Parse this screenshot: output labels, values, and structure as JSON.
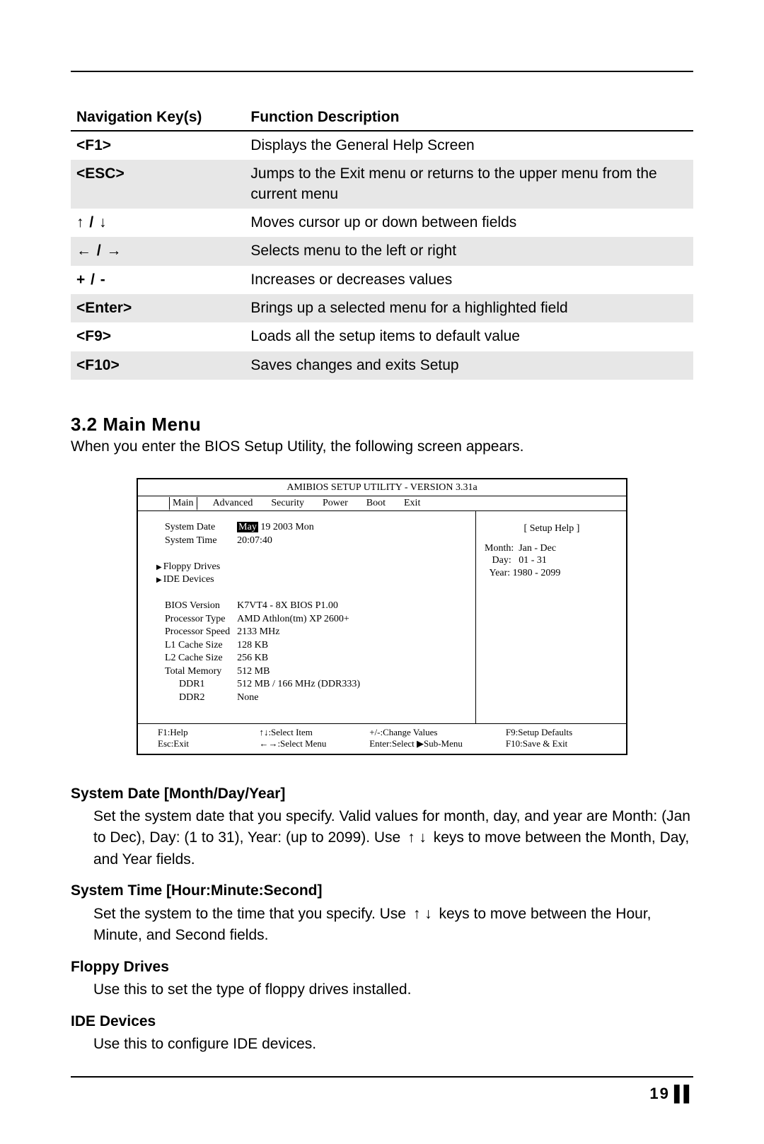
{
  "nav_table": {
    "headers": [
      "Navigation Key(s)",
      "Function Description"
    ],
    "rows": [
      {
        "key": "<F1>",
        "desc": "Displays the General Help Screen",
        "shade": false
      },
      {
        "key": "<ESC>",
        "desc": "Jumps to the Exit menu or returns to the upper menu from the current menu",
        "shade": true
      },
      {
        "key": "↑  /  ↓",
        "desc": "Moves cursor up or down between fields",
        "shade": false,
        "sym": true
      },
      {
        "key": "←  /  →",
        "desc": "Selects menu to the left or right",
        "shade": true,
        "sym": true
      },
      {
        "key": "+  /  -",
        "desc": "Increases or decreases values",
        "shade": false,
        "sym": true
      },
      {
        "key": "<Enter>",
        "desc": "Brings up a selected menu for a highlighted field",
        "shade": true
      },
      {
        "key": "<F9>",
        "desc": "Loads all the setup items to default value",
        "shade": false
      },
      {
        "key": "<F10>",
        "desc": "Saves changes and exits Setup",
        "shade": true
      }
    ]
  },
  "section": {
    "heading": "3.2 Main Menu",
    "intro": "When you enter the BIOS Setup Utility, the following screen appears."
  },
  "bios": {
    "title": "AMIBIOS SETUP UTILITY - VERSION 3.31a",
    "tabs": [
      "Main",
      "Advanced",
      "Security",
      "Power",
      "Boot",
      "Exit"
    ],
    "active_tab": 0,
    "date_label": "System Date",
    "date_value_hi": "May",
    "date_value_rest": "19 2003 Mon",
    "time_label": "System Time",
    "time_value": "20:07:40",
    "submenus": [
      "Floppy Drives",
      "IDE Devices"
    ],
    "info": [
      {
        "label": "BIOS Version",
        "value": "K7VT4 - 8X  BIOS  P1.00"
      },
      {
        "label": "Processor Type",
        "value": "AMD Athlon(tm) XP 2600+"
      },
      {
        "label": "Processor Speed",
        "value": "2133 MHz"
      },
      {
        "label": "L1 Cache Size",
        "value": "128 KB"
      },
      {
        "label": "L2 Cache Size",
        "value": "256 KB"
      },
      {
        "label": "Total Memory",
        "value": "512 MB"
      },
      {
        "label": "DDR1",
        "value": "512 MB / 166 MHz (DDR333)",
        "indent": true
      },
      {
        "label": "DDR2",
        "value": "None",
        "indent": true
      }
    ],
    "help_title": "[   Setup Help   ]",
    "help_lines": [
      "Month:  Jan - Dec",
      "   Day:   01 - 31",
      "  Year: 1980 - 2099"
    ],
    "footer": [
      [
        "F1:Help",
        "↑↓:Select Item",
        "+/-:Change Values",
        "F9:Setup Defaults"
      ],
      [
        "Esc:Exit",
        "←→:Select Menu",
        "Enter:Select  ▶Sub-Menu",
        "F10:Save & Exit"
      ]
    ]
  },
  "descriptions": [
    {
      "title": "System Date [Month/Day/Year]",
      "body_pre": "Set the system date that you specify. Valid values for month, day, and year are Month: (Jan to Dec), Day: (1 to 31), Year: (up to 2099). Use ",
      "arrows": "↑   ↓",
      "body_post": " keys to move between the Month, Day, and Year fields."
    },
    {
      "title": "System Time [Hour:Minute:Second]",
      "body_pre": "Set the system to the time that you specify. Use ",
      "arrows": "↑   ↓",
      "body_post": " keys to move between the Hour, Minute, and Second fields."
    },
    {
      "title": "Floppy Drives",
      "body_pre": "Use this to set the type of floppy drives installed.",
      "arrows": "",
      "body_post": ""
    },
    {
      "title": "IDE Devices",
      "body_pre": "Use this to configure IDE devices.",
      "arrows": "",
      "body_post": ""
    }
  ],
  "page_number": "19"
}
